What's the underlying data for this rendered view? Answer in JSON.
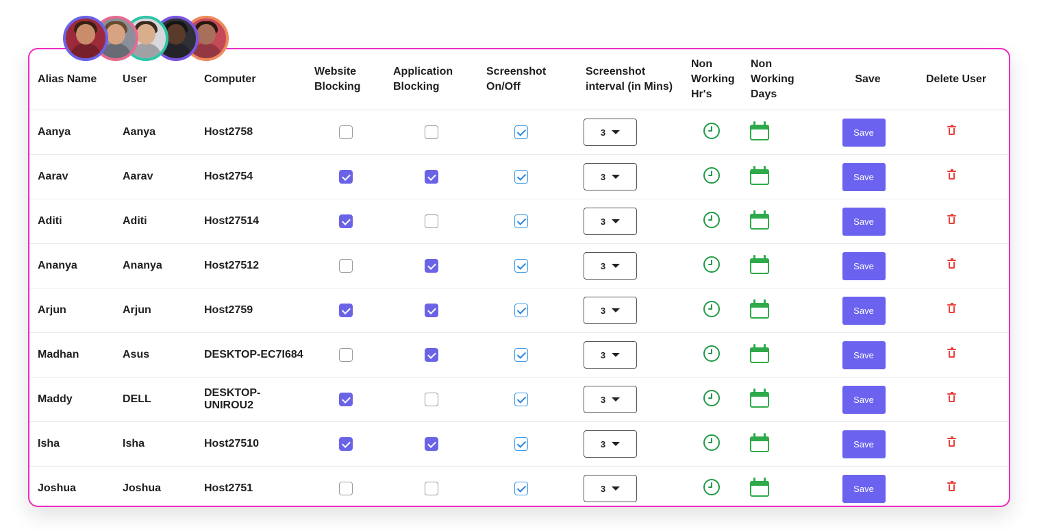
{
  "avatars": [
    {
      "name": "avatar-woman-1",
      "border": "#6b63e6",
      "bg": "#9d2a3a",
      "skin": "#c98d6b",
      "hair": "#3a2013"
    },
    {
      "name": "avatar-man-1",
      "border": "#e86b8f",
      "bg": "#8a8f99",
      "skin": "#d7a383",
      "hair": "#6b4b30"
    },
    {
      "name": "avatar-man-2",
      "border": "#2cc5a6",
      "bg": "#d7d7dc",
      "skin": "#d9ae8d",
      "hair": "#3b2a1e"
    },
    {
      "name": "avatar-man-3",
      "border": "#7a55e0",
      "bg": "#2f2f36",
      "skin": "#5a3a28",
      "hair": "#151515"
    },
    {
      "name": "avatar-woman-2",
      "border": "#ef8a5c",
      "bg": "#c44a58",
      "skin": "#a8705a",
      "hair": "#2a1810"
    }
  ],
  "columns": {
    "alias": "Alias Name",
    "user": "User",
    "computer": "Computer",
    "website_blocking": "Website Blocking",
    "application_blocking": "Application Blocking",
    "screenshot_toggle": "Screenshot On/Off",
    "screenshot_interval": "Screenshot interval (in Mins)",
    "non_working_hrs": "Non Working Hr's",
    "non_working_days": "Non Working Days",
    "save": "Save",
    "delete_user": "Delete User"
  },
  "rows": [
    {
      "alias": "Aanya",
      "user": "Aanya",
      "computer": "Host2758",
      "website_blocking": false,
      "application_blocking": false,
      "screenshot": true,
      "interval": "3",
      "save_label": "Save"
    },
    {
      "alias": "Aarav",
      "user": "Aarav",
      "computer": "Host2754",
      "website_blocking": true,
      "application_blocking": true,
      "screenshot": true,
      "interval": "3",
      "save_label": "Save"
    },
    {
      "alias": "Aditi",
      "user": "Aditi",
      "computer": "Host27514",
      "website_blocking": true,
      "application_blocking": false,
      "screenshot": true,
      "interval": "3",
      "save_label": "Save"
    },
    {
      "alias": "Ananya",
      "user": "Ananya",
      "computer": "Host27512",
      "website_blocking": false,
      "application_blocking": true,
      "screenshot": true,
      "interval": "3",
      "save_label": "Save"
    },
    {
      "alias": "Arjun",
      "user": "Arjun",
      "computer": "Host2759",
      "website_blocking": true,
      "application_blocking": true,
      "screenshot": true,
      "interval": "3",
      "save_label": "Save"
    },
    {
      "alias": "Madhan",
      "user": "Asus",
      "computer": "DESKTOP-EC7I684",
      "website_blocking": false,
      "application_blocking": true,
      "screenshot": true,
      "interval": "3",
      "save_label": "Save"
    },
    {
      "alias": "Maddy",
      "user": "DELL",
      "computer": "DESKTOP-UNIROU2",
      "website_blocking": true,
      "application_blocking": false,
      "screenshot": true,
      "interval": "3",
      "save_label": "Save"
    },
    {
      "alias": "Isha",
      "user": "Isha",
      "computer": "Host27510",
      "website_blocking": true,
      "application_blocking": true,
      "screenshot": true,
      "interval": "3",
      "save_label": "Save"
    },
    {
      "alias": "Joshua",
      "user": "Joshua",
      "computer": "Host2751",
      "website_blocking": false,
      "application_blocking": false,
      "screenshot": true,
      "interval": "3",
      "save_label": "Save"
    }
  ],
  "icons": {
    "interval_dropdown": "caret-down-icon",
    "non_working_hrs": "clock-icon",
    "non_working_days": "calendar-icon",
    "delete": "trash-icon"
  },
  "colors": {
    "card_border": "#ee2bc1",
    "accent": "#6b63e6",
    "save_button": "#6b63f0",
    "screenshot_check": "#2a86df",
    "clock": "#1f9b45",
    "calendar": "#2eaa4a",
    "trash": "#e8413c"
  }
}
